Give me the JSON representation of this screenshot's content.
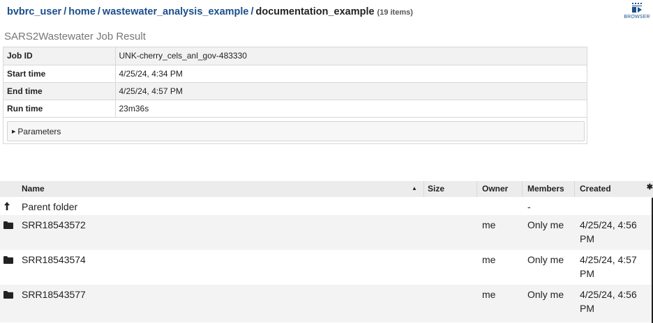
{
  "breadcrumb": {
    "parts": [
      "bvbrc_user",
      "home",
      "wastewater_analysis_example"
    ],
    "current": "documentation_example",
    "count": "(19 items)"
  },
  "browser_button": {
    "label": "BROWSER",
    "icon": "browser-grid-icon"
  },
  "job": {
    "title": "SARS2Wastewater Job Result",
    "rows": [
      {
        "key": "Job ID",
        "value": "UNK-cherry_cels_anl_gov-483330"
      },
      {
        "key": "Start time",
        "value": "4/25/24, 4:34 PM"
      },
      {
        "key": "End time",
        "value": "4/25/24, 4:57 PM"
      },
      {
        "key": "Run time",
        "value": "23m36s"
      }
    ],
    "parameters_label": "Parameters"
  },
  "grid": {
    "headers": {
      "name": "Name",
      "size": "Size",
      "owner": "Owner",
      "members": "Members",
      "created": "Created"
    },
    "sort_indicator": "▲",
    "settings_icon": "gear-icon",
    "parent": {
      "label": "Parent folder",
      "members": "-",
      "icon": "up-arrow-icon"
    },
    "rows": [
      {
        "name": "SRR18543572",
        "owner": "me",
        "members": "Only me",
        "created_1": "4/25/24, 4:56",
        "created_2": "PM",
        "icon": "folder-icon"
      },
      {
        "name": "SRR18543574",
        "owner": "me",
        "members": "Only me",
        "created_1": "4/25/24, 4:57",
        "created_2": "PM",
        "icon": "folder-icon"
      },
      {
        "name": "SRR18543577",
        "owner": "me",
        "members": "Only me",
        "created_1": "4/25/24, 4:56",
        "created_2": "PM",
        "icon": "folder-icon"
      }
    ]
  }
}
